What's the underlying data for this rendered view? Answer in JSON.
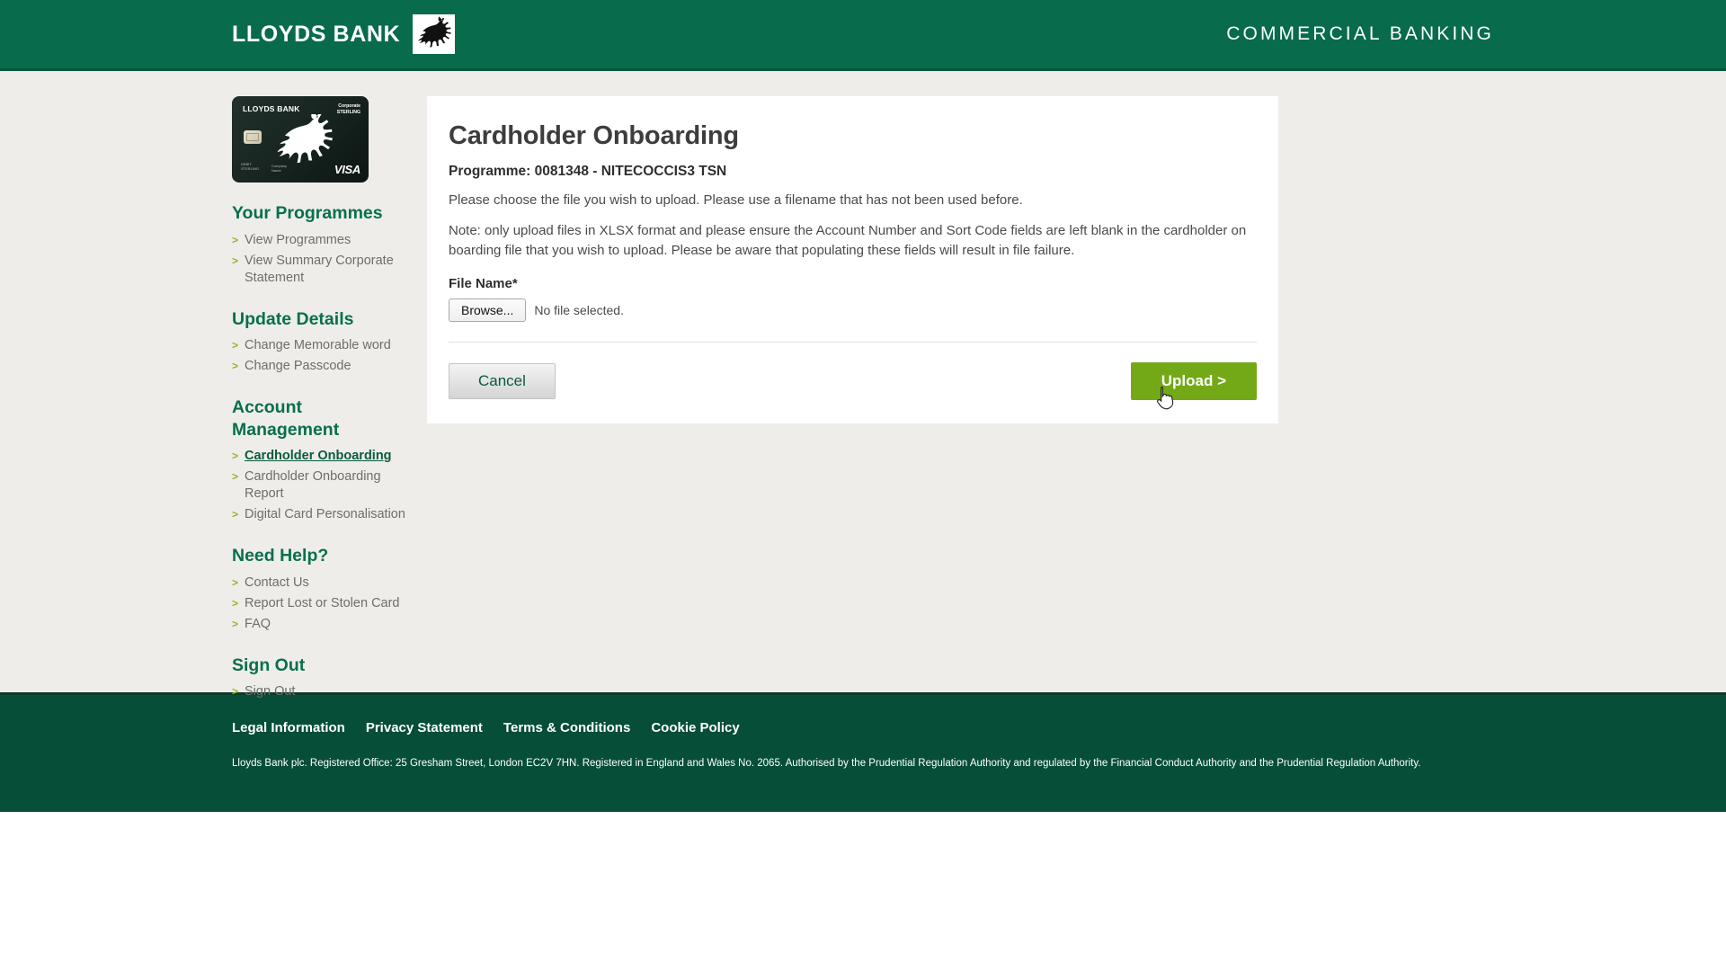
{
  "header": {
    "brand_name": "LLOYDS BANK",
    "brand_mark_icon": "lloyds-black-horse-icon",
    "division": "COMMERCIAL BANKING",
    "background_color": "#076b4c"
  },
  "sidebar": {
    "card_image": {
      "bank_name": "LLOYDS BANK",
      "product": "Corporate\nSTERLING",
      "network": "VISA",
      "horse_icon": "lloyds-white-horse-icon",
      "chip_icon": "emv-chip-icon",
      "tiny_left": "DEBIT\nSTERLING",
      "tiny_mid": "Company\nName"
    },
    "sections": [
      {
        "heading": "Your Programmes",
        "items": [
          {
            "label": "View Programmes",
            "active": false
          },
          {
            "label": "View Summary Corporate Statement",
            "active": false
          }
        ]
      },
      {
        "heading": "Update Details",
        "items": [
          {
            "label": "Change Memorable word",
            "active": false
          },
          {
            "label": "Change Passcode",
            "active": false
          }
        ]
      },
      {
        "heading": "Account Management",
        "items": [
          {
            "label": "Cardholder Onboarding",
            "active": true
          },
          {
            "label": "Cardholder Onboarding Report",
            "active": false
          },
          {
            "label": "Digital Card Personalisation",
            "active": false
          }
        ]
      },
      {
        "heading": "Need Help?",
        "items": [
          {
            "label": "Contact Us",
            "active": false
          },
          {
            "label": "Report Lost or Stolen Card",
            "active": false
          },
          {
            "label": "FAQ",
            "active": false
          }
        ]
      },
      {
        "heading": "Sign Out",
        "items": [
          {
            "label": "Sign Out",
            "active": false
          }
        ]
      }
    ],
    "bullet_glyph": ">",
    "bullet_color": "#93b528",
    "heading_color": "#06704d"
  },
  "main": {
    "title": "Cardholder Onboarding",
    "programme": "Programme: 0081348 - NITECOCCIS3 TSN",
    "intro": "Please choose the file you wish to upload. Please use a filename that has not been used before.",
    "note": "Note: only upload files in XLSX format and please ensure the Account Number and Sort Code fields are left blank in the cardholder on boarding file that you wish to upload. Please be aware that populating these fields will result in file failure.",
    "file_field": {
      "label": "File Name*",
      "browse_label": "Browse...",
      "status": "No file selected."
    },
    "cancel_label": "Cancel",
    "upload_label": "Upload >",
    "upload_color": "#73a916",
    "cursor_icon": "pointing-hand-cursor"
  },
  "footer": {
    "links": [
      "Legal Information",
      "Privacy Statement",
      "Terms & Conditions",
      "Cookie Policy"
    ],
    "legal": "Lloyds Bank plc. Registered Office: 25 Gresham Street, London EC2V 7HN. Registered in England and Wales No. 2065. Authorised by the Prudential Regulation Authority and regulated by the Financial Conduct Authority and the Prudential Regulation Authority.",
    "background_color": "#064e38"
  }
}
